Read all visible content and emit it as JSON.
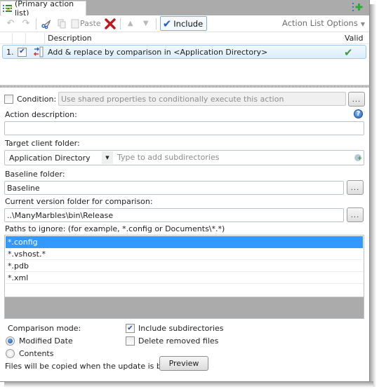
{
  "tab": {
    "title": "(Primary action list)"
  },
  "toolbar": {
    "undo_icon": "undo-icon",
    "redo_icon": "redo-icon",
    "cut_icon": "scissors-icon",
    "copy_icon": "copy-icon",
    "paste_label": "Paste",
    "delete_icon": "red-x-icon",
    "move_up_icon": "arrow-up-icon",
    "move_down_icon": "arrow-down-icon",
    "include_label": "Include",
    "options_label": "Action List Options"
  },
  "action_list": {
    "columns": {
      "description": "Description",
      "valid": "Valid"
    },
    "rows": [
      {
        "number": "1.",
        "checked": true,
        "description": "Add & replace by comparison in <Application Directory>",
        "valid": true
      }
    ]
  },
  "form": {
    "condition": {
      "label": "Condition:",
      "checked": false,
      "placeholder": "Use shared properties to conditionally execute this action",
      "browse_label": "..."
    },
    "action_description": {
      "label": "Action description:",
      "value": ""
    },
    "target_client_folder": {
      "label": "Target client folder:",
      "selected": "Application Directory",
      "subdir_placeholder": "Type to add subdirectories"
    },
    "baseline_folder": {
      "label": "Baseline folder:",
      "value": "Baseline",
      "browse_label": "..."
    },
    "current_version_folder": {
      "label": "Current version folder for comparison:",
      "value": "..\\ManyMarbles\\bin\\Release",
      "browse_label": "..."
    },
    "paths_to_ignore": {
      "label": "Paths to ignore: (for example, *.config or Documents\\*.*)",
      "items": [
        "*.config",
        "*.vshost.*",
        "*.pdb",
        "*.xml"
      ],
      "selected_index": 0
    },
    "comparison_mode": {
      "label": "Comparison mode:",
      "options": [
        "Modified Date",
        "Contents"
      ],
      "selected": "Modified Date"
    },
    "include_subdirectories": {
      "label": "Include subdirectories",
      "checked": true
    },
    "delete_removed_files": {
      "label": "Delete removed files",
      "checked": false
    },
    "footer_note": "Files will be copied when the update is built.",
    "preview_label": "Preview"
  }
}
